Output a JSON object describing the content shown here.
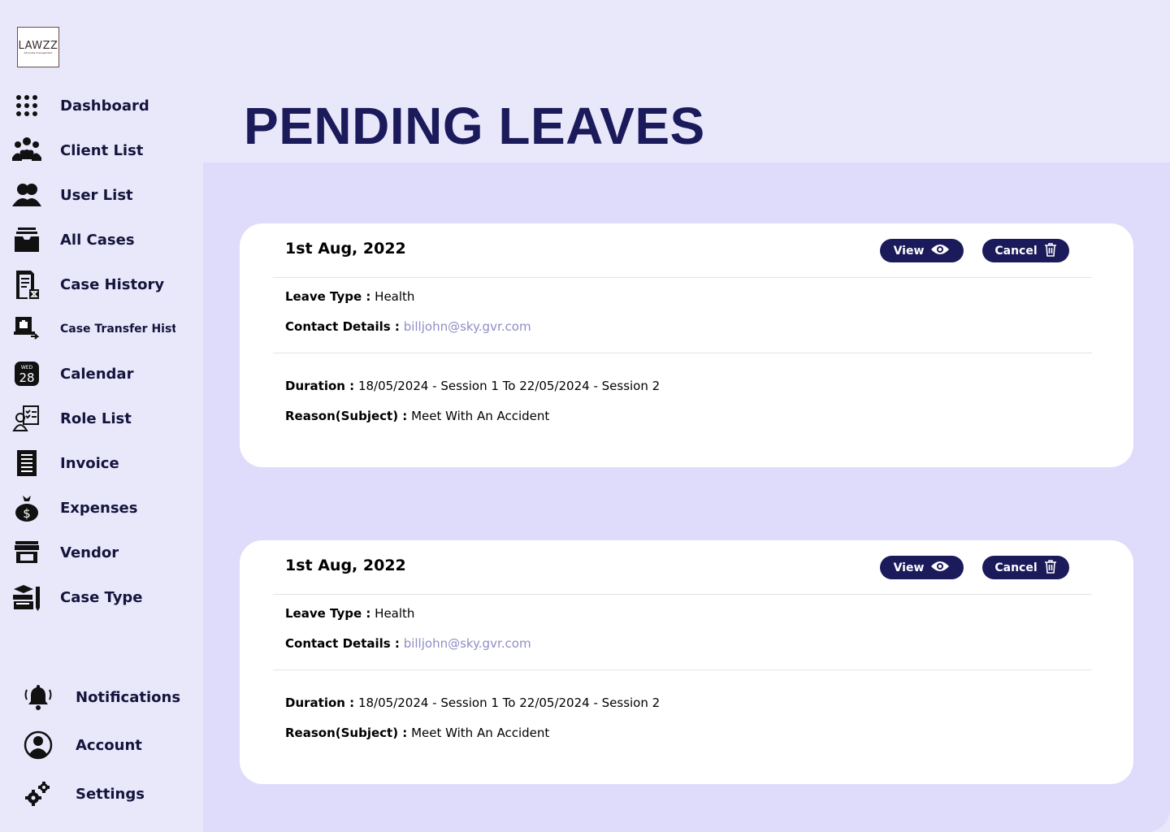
{
  "logo": {
    "main": "LAWZZ",
    "sub": "advocate management"
  },
  "sidebar": {
    "items": [
      {
        "label": "Dashboard",
        "icon": "grid-dots-icon"
      },
      {
        "label": "Client List",
        "icon": "group-icon"
      },
      {
        "label": "User List",
        "icon": "users-icon"
      },
      {
        "label": "All Cases",
        "icon": "inbox-tray-icon"
      },
      {
        "label": "Case History",
        "icon": "document-hourglass-icon"
      },
      {
        "label": "Case Transfer Hist",
        "icon": "briefcase-transfer-icon"
      },
      {
        "label": "Calendar",
        "icon": "calendar-icon",
        "badge_day": "WED",
        "badge_date": "28"
      },
      {
        "label": "Role List",
        "icon": "user-checklist-icon"
      },
      {
        "label": "Invoice",
        "icon": "receipt-icon"
      },
      {
        "label": "Expenses",
        "icon": "money-bag-icon"
      },
      {
        "label": "Vendor",
        "icon": "storefront-icon"
      },
      {
        "label": "Case Type",
        "icon": "books-pen-icon"
      }
    ],
    "bottom": [
      {
        "label": "Notifications",
        "icon": "bell-icon"
      },
      {
        "label": "Account",
        "icon": "user-circle-icon"
      },
      {
        "label": "Settings",
        "icon": "gears-icon"
      }
    ]
  },
  "page": {
    "title": "PENDING LEAVES"
  },
  "cards": [
    {
      "date": "1st Aug, 2022",
      "view_label": "View",
      "cancel_label": "Cancel",
      "leave_type_key": "Leave Type :",
      "leave_type": "Health",
      "contact_key": "Contact Details :",
      "contact": "billjohn@sky.gvr.com",
      "duration_key": "Duration :",
      "duration": "18/05/2024 - Session 1 To 22/05/2024 - Session 2",
      "reason_key": "Reason(Subject) :",
      "reason": "Meet With An Accident"
    },
    {
      "date": "1st Aug, 2022",
      "view_label": "View",
      "cancel_label": "Cancel",
      "leave_type_key": "Leave Type :",
      "leave_type": "Health",
      "contact_key": "Contact Details :",
      "contact": "billjohn@sky.gvr.com",
      "duration_key": "Duration :",
      "duration": "18/05/2024 - Session 1 To 22/05/2024 - Session 2",
      "reason_key": "Reason(Subject) :",
      "reason": "Meet With An Accident"
    }
  ],
  "colors": {
    "accent": "#1b1a5a",
    "background": "#e9e8fb",
    "content_bg": "#dedcfa",
    "email": "#8f8dc7"
  }
}
